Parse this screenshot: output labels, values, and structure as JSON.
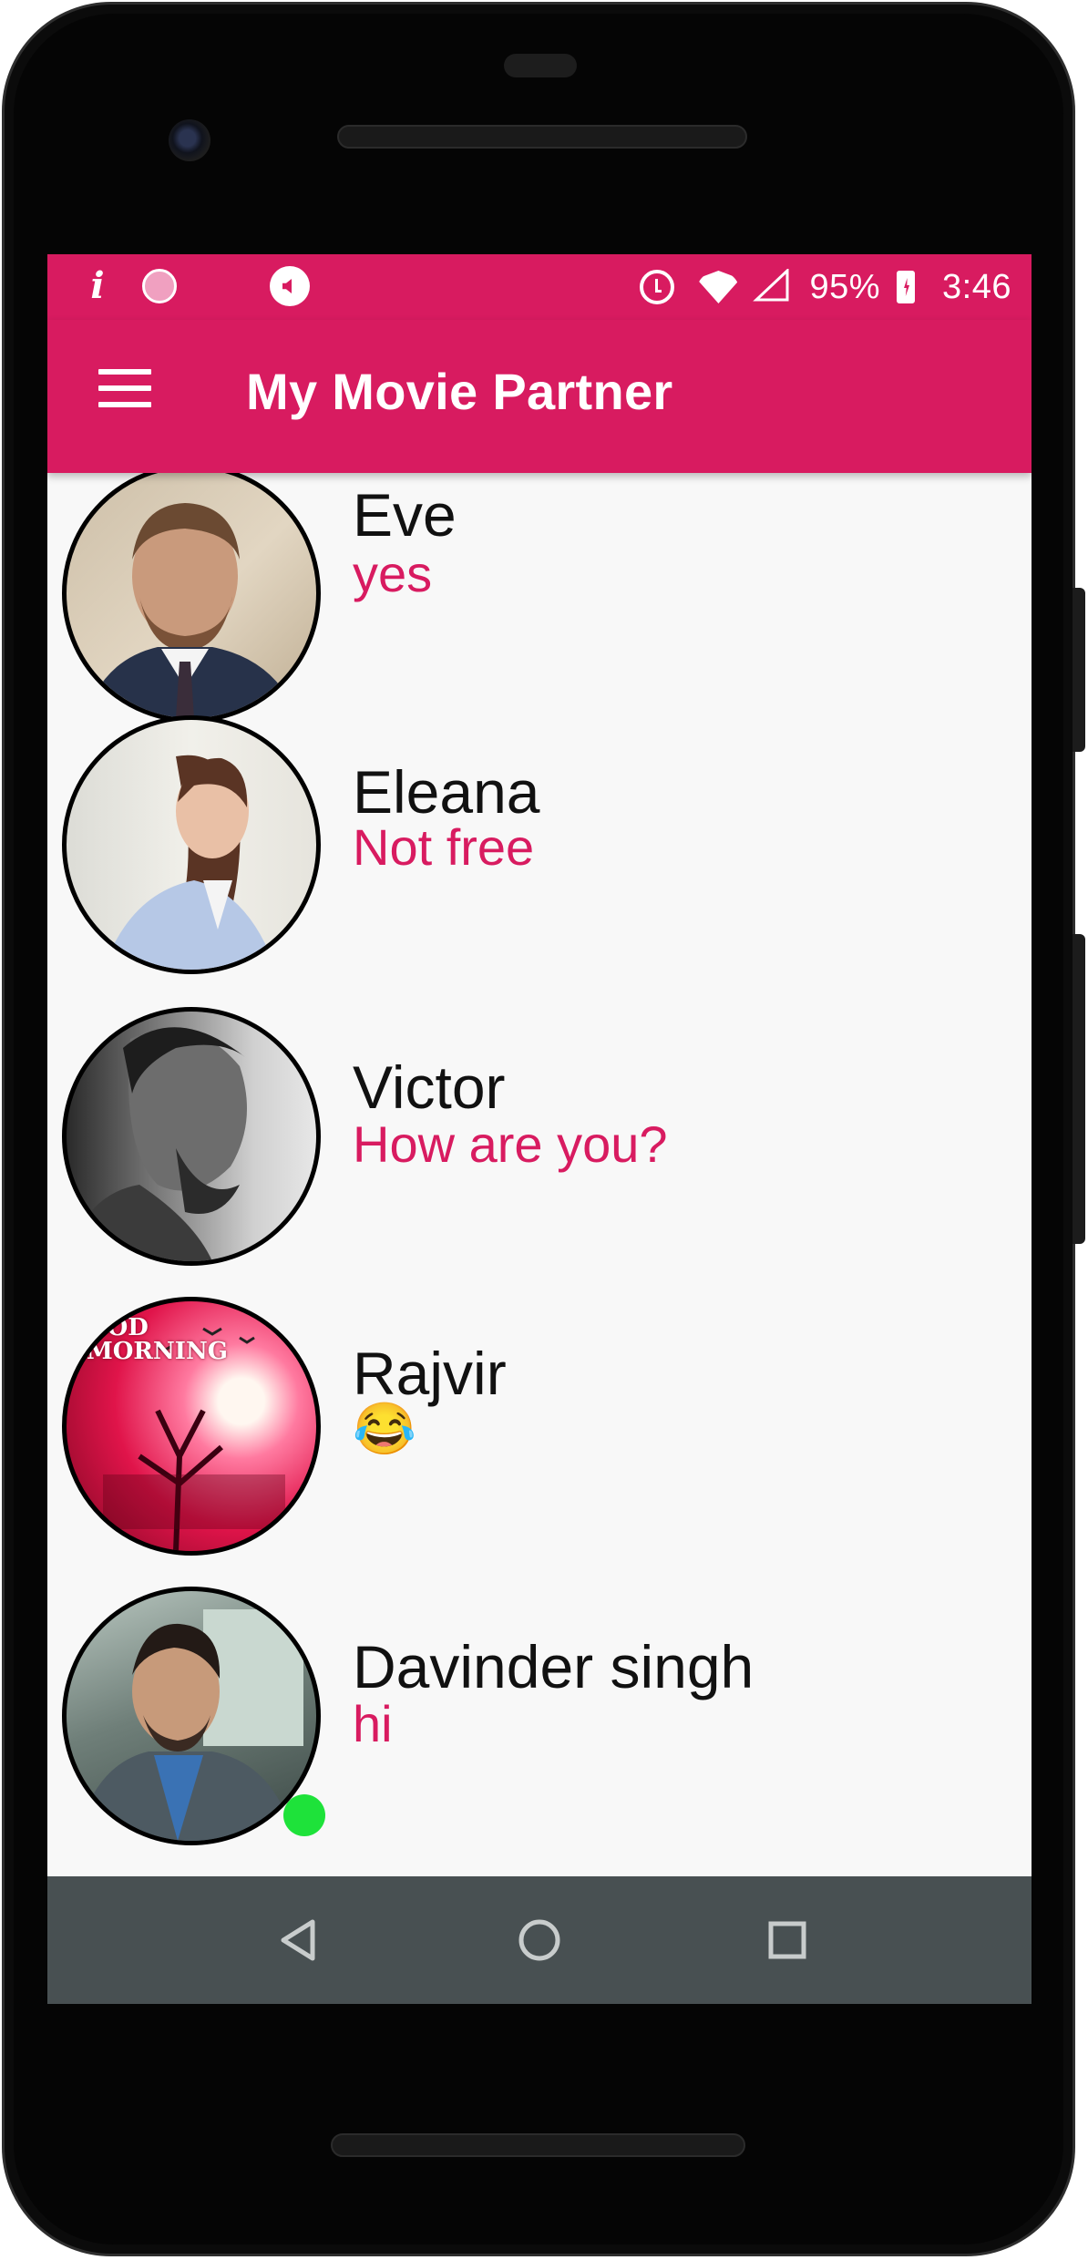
{
  "status_bar": {
    "battery": "95%",
    "time": "3:46",
    "icons": [
      "info-icon",
      "loading-icon",
      "sound-icon",
      "alarm-icon",
      "wifi-icon",
      "signal-icon",
      "battery-icon"
    ]
  },
  "app_bar": {
    "title": "My Movie Partner",
    "menu_icon": "hamburger-menu-icon"
  },
  "chats": [
    {
      "name": "Eve",
      "last_message": "yes",
      "online": false
    },
    {
      "name": "Eleana",
      "last_message": "Not free",
      "online": false
    },
    {
      "name": "Victor",
      "last_message": "How are you?",
      "online": false
    },
    {
      "name": "Rajvir",
      "last_message": "😂",
      "online": false,
      "avatar_text": "OOD MORNING"
    },
    {
      "name": "Davinder singh",
      "last_message": "hi",
      "online": true
    }
  ],
  "nav_bar": {
    "icons": [
      "back-icon",
      "home-icon",
      "recent-apps-icon"
    ]
  },
  "colors": {
    "primary": "#d81b60",
    "online": "#1ee23a",
    "nav_bar": "#485052",
    "background": "#f8f8f8"
  }
}
